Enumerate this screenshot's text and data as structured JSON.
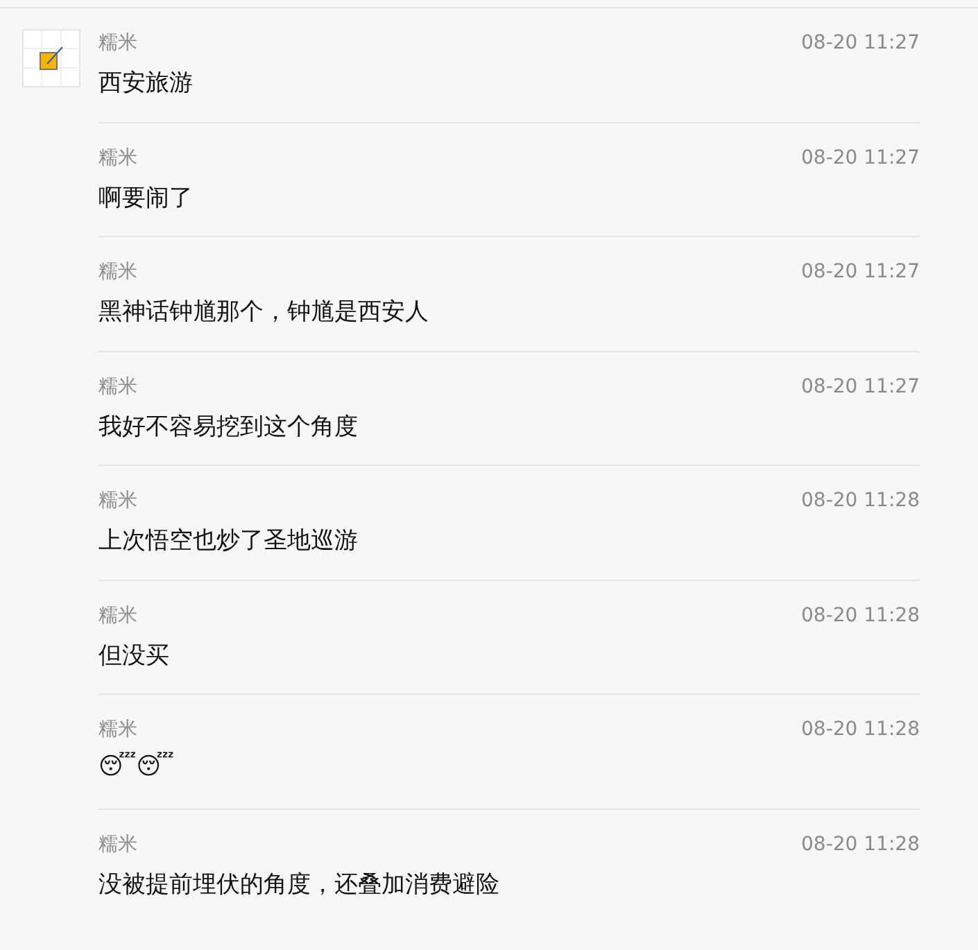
{
  "messages": [
    {
      "sender": "糯米",
      "time": "08-20 11:27",
      "text": "西安旅游",
      "show_avatar": true
    },
    {
      "sender": "糯米",
      "time": "08-20 11:27",
      "text": "啊要闹了",
      "show_avatar": false
    },
    {
      "sender": "糯米",
      "time": "08-20 11:27",
      "text": "黑神话钟馗那个，钟馗是西安人",
      "show_avatar": false
    },
    {
      "sender": "糯米",
      "time": "08-20 11:27",
      "text": "我好不容易挖到这个角度",
      "show_avatar": false
    },
    {
      "sender": "糯米",
      "time": "08-20 11:28",
      "text": "上次悟空也炒了圣地巡游",
      "show_avatar": false
    },
    {
      "sender": "糯米",
      "time": "08-20 11:28",
      "text": "但没买",
      "show_avatar": false
    },
    {
      "sender": "糯米",
      "time": "08-20 11:28",
      "text": "😴😴",
      "show_avatar": false
    },
    {
      "sender": "糯米",
      "time": "08-20 11:28",
      "text": "没被提前埋伏的角度，还叠加消费避险",
      "show_avatar": false
    }
  ]
}
